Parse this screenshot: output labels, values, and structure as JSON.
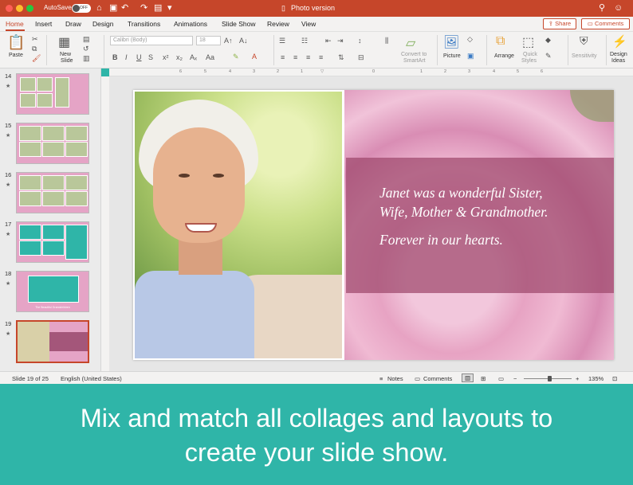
{
  "window": {
    "title": "Photo version",
    "autosave_label": "AutoSave",
    "autosave_state": "OFF"
  },
  "colors": {
    "brand": "#c6462a",
    "teal": "#2fb5a8",
    "rose_band": "#9e486c"
  },
  "titlebar_icons": [
    "home-icon",
    "save-icon",
    "undo-icon",
    "redo-icon",
    "template-icon",
    "print-icon",
    "customize-icon",
    "search-icon",
    "smiley-icon"
  ],
  "tabs": [
    "Home",
    "Insert",
    "Draw",
    "Design",
    "Transitions",
    "Animations",
    "Slide Show",
    "Review",
    "View"
  ],
  "active_tab": "Home",
  "share_label": "Share",
  "comments_label": "Comments",
  "ribbon": {
    "paste": "Paste",
    "new_slide_1": "New",
    "new_slide_2": "Slide",
    "font_name": "Calibri (Body)",
    "font_size": "18",
    "convert_1": "Convert to",
    "convert_2": "SmartArt",
    "picture": "Picture",
    "arrange": "Arrange",
    "quick_styles_1": "Quick",
    "quick_styles_2": "Styles",
    "sensitivity": "Sensitivity",
    "design_ideas_1": "Design",
    "design_ideas_2": "Ideas"
  },
  "ruler_labels": [
    "6",
    "5",
    "4",
    "3",
    "2",
    "1",
    "0",
    "1",
    "2",
    "3",
    "4",
    "5",
    "6"
  ],
  "thumbnails": [
    {
      "number": "14",
      "caption": ""
    },
    {
      "number": "15",
      "caption": ""
    },
    {
      "number": "16",
      "caption": ""
    },
    {
      "number": "17",
      "caption": ""
    },
    {
      "number": "18",
      "caption": "The Beautiful Grandchildren"
    },
    {
      "number": "19",
      "caption": ""
    }
  ],
  "slide": {
    "line1": "Janet was a wonderful Sister,",
    "line2": "Wife, Mother & Grandmother.",
    "line3": "Forever in our hearts."
  },
  "status": {
    "slide_counter": "Slide 19 of 25",
    "language": "English (United States)",
    "notes": "Notes",
    "comments": "Comments",
    "zoom": "135%"
  },
  "banner": {
    "line1": "Mix and match all collages and layouts to",
    "line2": "create your slide show."
  }
}
